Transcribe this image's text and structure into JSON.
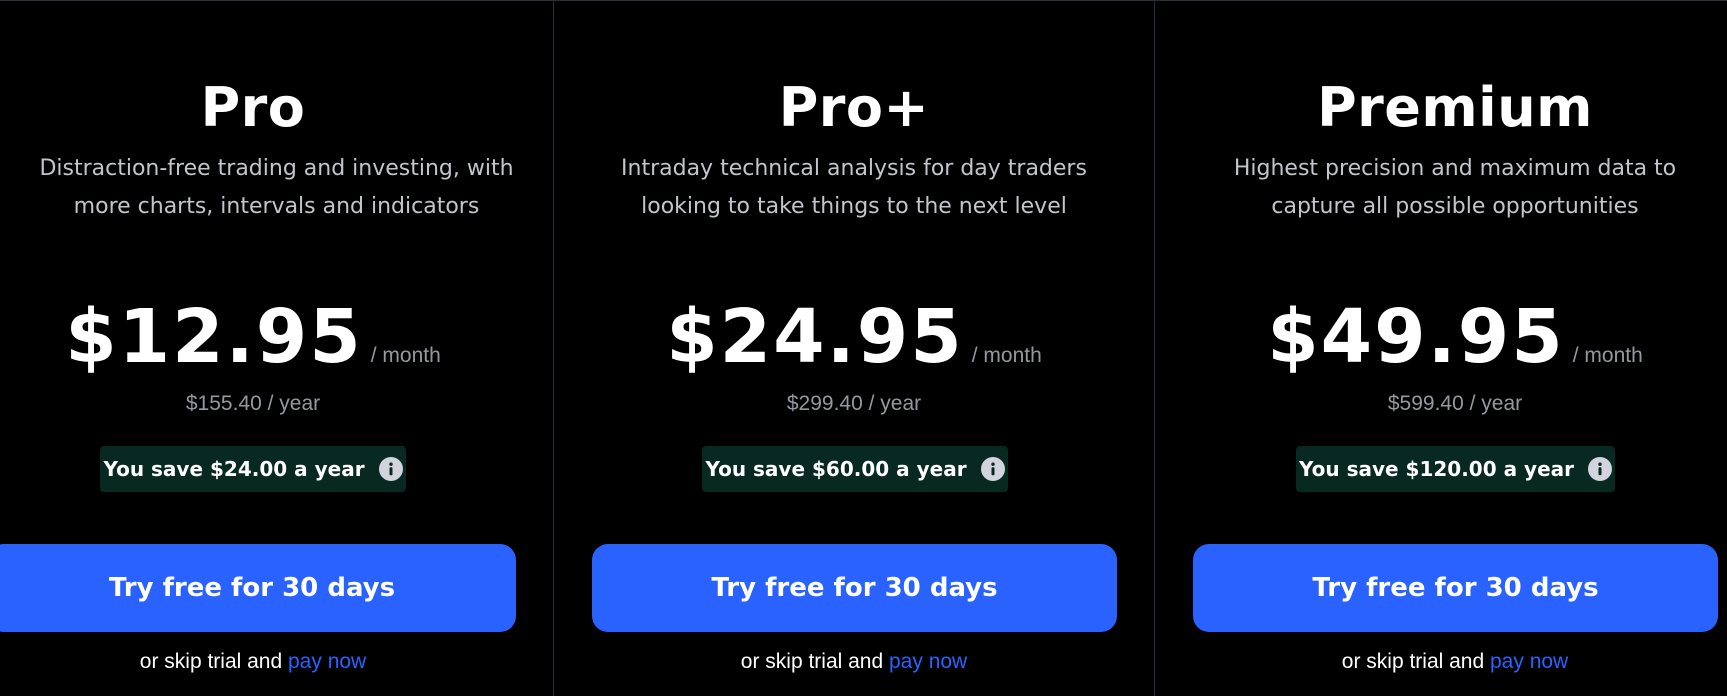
{
  "plans": [
    {
      "name": "Pro",
      "description_line1": "Distraction-free trading and investing, with",
      "description_line2": "more charts, intervals and indicators",
      "price": "$12.95",
      "per_month": "/ month",
      "per_year": "$155.40 / year",
      "savings": "You save $24.00 a year",
      "cta_label": "Try free for 30 days",
      "skip_text": "or skip trial and",
      "pay_link": "pay now"
    },
    {
      "name": "Pro+",
      "description_line1": "Intraday technical analysis for day traders",
      "description_line2": "looking to take things to the next level",
      "price": "$24.95",
      "per_month": "/ month",
      "per_year": "$299.40 / year",
      "savings": "You save $60.00 a year",
      "cta_label": "Try free for 30 days",
      "skip_text": "or skip trial and",
      "pay_link": "pay now"
    },
    {
      "name": "Premium",
      "description_line1": "Highest precision and maximum data to",
      "description_line2": "capture all possible opportunities",
      "price": "$49.95",
      "per_month": "/ month",
      "per_year": "$599.40 / year",
      "savings": "You save $120.00 a year",
      "cta_label": "Try free for 30 days",
      "skip_text": "or skip trial and",
      "pay_link": "pay now"
    }
  ],
  "icons": {
    "savings_info": "info-icon"
  },
  "colors": {
    "background": "#000000",
    "accent": "#2962ff",
    "savings_badge": "#082822",
    "muted_text": "#9598a1"
  }
}
